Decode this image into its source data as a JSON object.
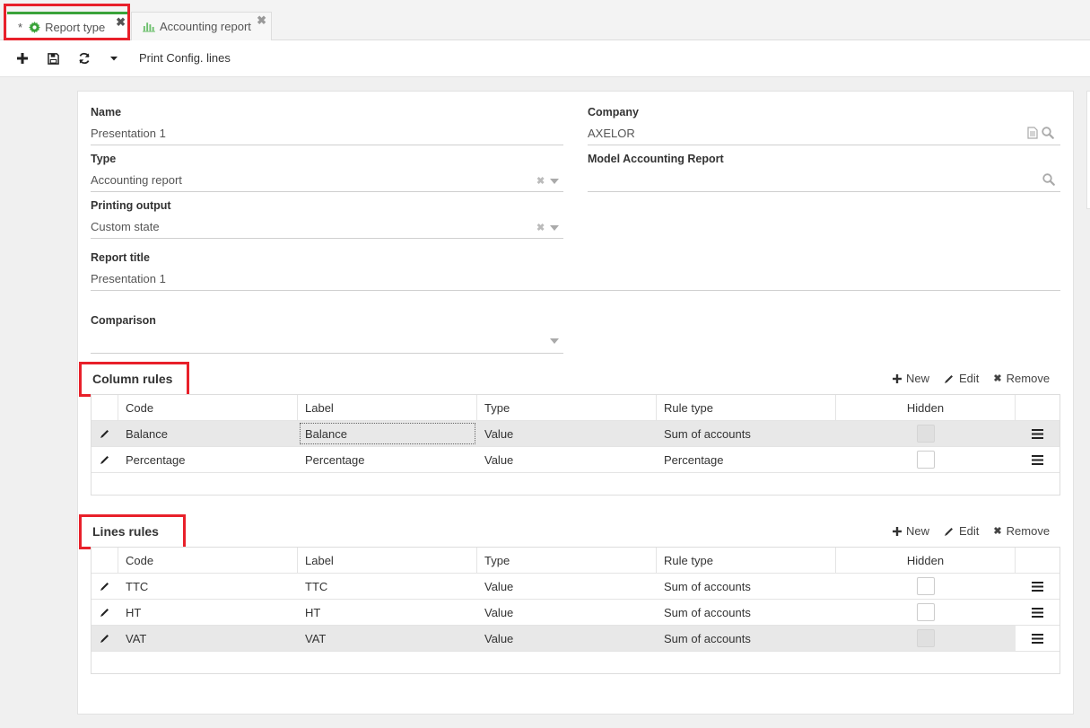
{
  "tabs": [
    {
      "label": "Report type",
      "modified_marker": "*",
      "icon": "gear-icon",
      "active": true
    },
    {
      "label": "Accounting report",
      "icon": "bar-chart-icon",
      "active": false
    }
  ],
  "toolbar": {
    "icons": [
      "plus-icon",
      "save-icon",
      "refresh-icon",
      "caret-down-icon"
    ],
    "print_config_label": "Print Config. lines"
  },
  "form": {
    "name": {
      "label": "Name",
      "value": "Presentation 1"
    },
    "company": {
      "label": "Company",
      "value": "AXELOR"
    },
    "type": {
      "label": "Type",
      "value": "Accounting report"
    },
    "model_accounting_report": {
      "label": "Model Accounting Report",
      "value": ""
    },
    "printing_output": {
      "label": "Printing output",
      "value": "Custom state"
    },
    "report_title": {
      "label": "Report title",
      "value": "Presentation 1"
    },
    "comparison": {
      "label": "Comparison",
      "value": ""
    }
  },
  "actions": {
    "new": "New",
    "edit": "Edit",
    "remove": "Remove"
  },
  "column_rules": {
    "title": "Column rules",
    "headers": [
      "Code",
      "Label",
      "Type",
      "Rule type",
      "Hidden"
    ],
    "rows": [
      {
        "code": "Balance",
        "label": "Balance",
        "type": "Value",
        "rule_type": "Sum of accounts",
        "hidden": false,
        "selected": true
      },
      {
        "code": "Percentage",
        "label": "Percentage",
        "type": "Value",
        "rule_type": "Percentage",
        "hidden": false,
        "selected": false
      }
    ]
  },
  "lines_rules": {
    "title": "Lines rules",
    "headers": [
      "Code",
      "Label",
      "Type",
      "Rule type",
      "Hidden"
    ],
    "rows": [
      {
        "code": "TTC",
        "label": "TTC",
        "type": "Value",
        "rule_type": "Sum of accounts",
        "hidden": false,
        "selected": false
      },
      {
        "code": "HT",
        "label": "HT",
        "type": "Value",
        "rule_type": "Sum of accounts",
        "hidden": false,
        "selected": false
      },
      {
        "code": "VAT",
        "label": "VAT",
        "type": "Value",
        "rule_type": "Sum of accounts",
        "hidden": false,
        "selected": true
      }
    ]
  },
  "colors": {
    "accent_green": "#3aa33a",
    "highlight_red": "#e8202a",
    "selected_row": "#e8e8e8"
  }
}
